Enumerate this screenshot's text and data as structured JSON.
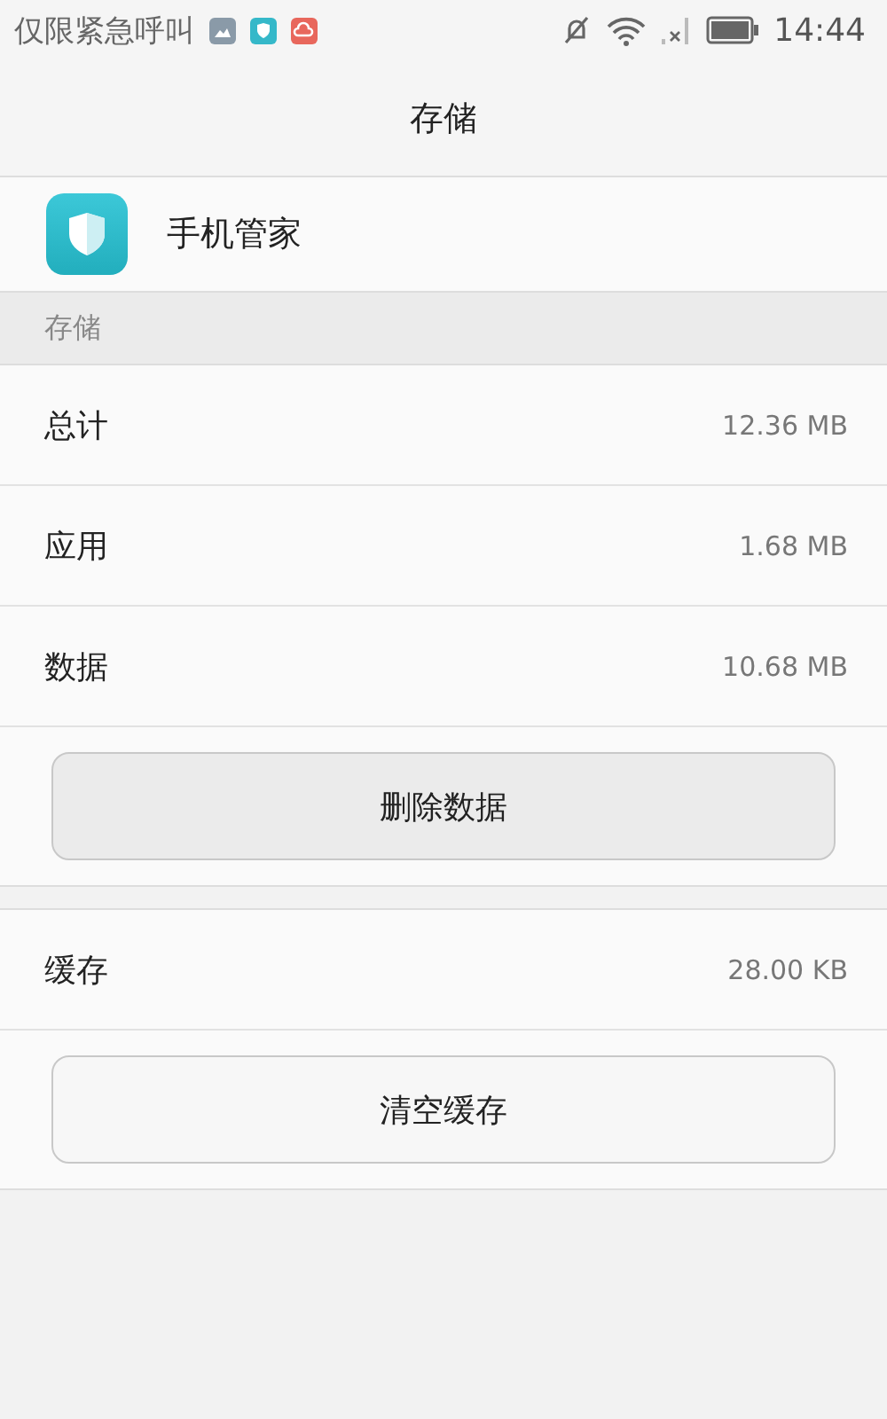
{
  "status_bar": {
    "carrier": "仅限紧急呼叫",
    "time": "14:44"
  },
  "title": "存储",
  "app": {
    "name": "手机管家"
  },
  "section_header": "存储",
  "groups": [
    {
      "rows": [
        {
          "label": "总计",
          "value": "12.36 MB"
        },
        {
          "label": "应用",
          "value": "1.68 MB"
        },
        {
          "label": "数据",
          "value": "10.68 MB"
        }
      ],
      "button": "删除数据"
    },
    {
      "rows": [
        {
          "label": "缓存",
          "value": "28.00 KB"
        }
      ],
      "button": "清空缓存"
    }
  ]
}
